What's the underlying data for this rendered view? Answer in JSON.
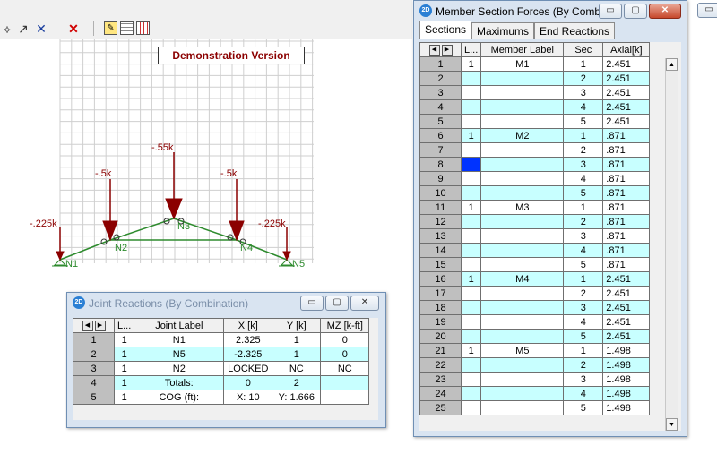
{
  "toolbar": {
    "icons": [
      "sharp-pointer-icon",
      "arrow-icon",
      "cross-arrow-icon",
      "delete-icon",
      "edit-icon",
      "grid-icon",
      "grid-dots-icon"
    ]
  },
  "canvas": {
    "demo_label": "Demonstration Version",
    "loads": [
      "-.225k",
      "-.5k",
      "-.55k",
      "-.5k",
      "-.225k"
    ],
    "nodes": [
      "N1",
      "N2",
      "N3",
      "N4",
      "N5"
    ]
  },
  "joint_window": {
    "title": "Joint Reactions (By Combination)",
    "headers": [
      "L...",
      "Joint Label",
      "X [k]",
      "Y [k]",
      "MZ [k-ft]"
    ],
    "rows": [
      {
        "n": "1",
        "l": "1",
        "label": "N1",
        "x": "2.325",
        "y": "1",
        "mz": "0"
      },
      {
        "n": "2",
        "l": "1",
        "label": "N5",
        "x": "-2.325",
        "y": "1",
        "mz": "0"
      },
      {
        "n": "3",
        "l": "1",
        "label": "N2",
        "x": "LOCKED",
        "y": "NC",
        "mz": "NC"
      },
      {
        "n": "4",
        "l": "1",
        "label": "Totals:",
        "x": "0",
        "y": "2",
        "mz": ""
      },
      {
        "n": "5",
        "l": "1",
        "label": "COG (ft):",
        "x": "X: 10",
        "y": "Y: 1.666",
        "mz": ""
      }
    ]
  },
  "member_window": {
    "title": "Member Section Forces (By Comb...",
    "tabs": [
      "Sections",
      "Maximums",
      "End Reactions"
    ],
    "headers": [
      "L...",
      "Member Label",
      "Sec",
      "Axial[k]"
    ],
    "rows": [
      {
        "n": "1",
        "l": "1",
        "label": "M1",
        "sec": "1",
        "axial": "2.451"
      },
      {
        "n": "2",
        "l": "",
        "label": "",
        "sec": "2",
        "axial": "2.451"
      },
      {
        "n": "3",
        "l": "",
        "label": "",
        "sec": "3",
        "axial": "2.451"
      },
      {
        "n": "4",
        "l": "",
        "label": "",
        "sec": "4",
        "axial": "2.451"
      },
      {
        "n": "5",
        "l": "",
        "label": "",
        "sec": "5",
        "axial": "2.451"
      },
      {
        "n": "6",
        "l": "1",
        "label": "M2",
        "sec": "1",
        "axial": ".871"
      },
      {
        "n": "7",
        "l": "",
        "label": "",
        "sec": "2",
        "axial": ".871"
      },
      {
        "n": "8",
        "l": "",
        "label": "",
        "sec": "3",
        "axial": ".871"
      },
      {
        "n": "9",
        "l": "",
        "label": "",
        "sec": "4",
        "axial": ".871"
      },
      {
        "n": "10",
        "l": "",
        "label": "",
        "sec": "5",
        "axial": ".871"
      },
      {
        "n": "11",
        "l": "1",
        "label": "M3",
        "sec": "1",
        "axial": ".871"
      },
      {
        "n": "12",
        "l": "",
        "label": "",
        "sec": "2",
        "axial": ".871"
      },
      {
        "n": "13",
        "l": "",
        "label": "",
        "sec": "3",
        "axial": ".871"
      },
      {
        "n": "14",
        "l": "",
        "label": "",
        "sec": "4",
        "axial": ".871"
      },
      {
        "n": "15",
        "l": "",
        "label": "",
        "sec": "5",
        "axial": ".871"
      },
      {
        "n": "16",
        "l": "1",
        "label": "M4",
        "sec": "1",
        "axial": "2.451"
      },
      {
        "n": "17",
        "l": "",
        "label": "",
        "sec": "2",
        "axial": "2.451"
      },
      {
        "n": "18",
        "l": "",
        "label": "",
        "sec": "3",
        "axial": "2.451"
      },
      {
        "n": "19",
        "l": "",
        "label": "",
        "sec": "4",
        "axial": "2.451"
      },
      {
        "n": "20",
        "l": "",
        "label": "",
        "sec": "5",
        "axial": "2.451"
      },
      {
        "n": "21",
        "l": "1",
        "label": "M5",
        "sec": "1",
        "axial": "1.498"
      },
      {
        "n": "22",
        "l": "",
        "label": "",
        "sec": "2",
        "axial": "1.498"
      },
      {
        "n": "23",
        "l": "",
        "label": "",
        "sec": "3",
        "axial": "1.498"
      },
      {
        "n": "24",
        "l": "",
        "label": "",
        "sec": "4",
        "axial": "1.498"
      },
      {
        "n": "25",
        "l": "",
        "label": "",
        "sec": "5",
        "axial": "1.498"
      }
    ]
  },
  "colors": {
    "load_red": "#8b0000",
    "member_green": "#2e8b2e",
    "cyan_row": "#c8ffff",
    "selection": "#0033ff",
    "window_frame": "#d9e4f1"
  }
}
